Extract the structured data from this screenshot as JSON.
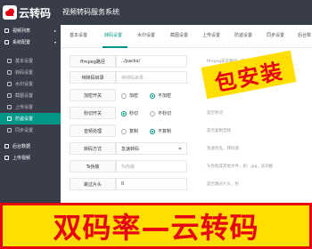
{
  "header": {
    "logo_text": "云转码",
    "app_title": "视频转码服务系统"
  },
  "sidebar": {
    "items": [
      {
        "label": "视频列表",
        "icon": "video-list-icon"
      },
      {
        "label": "系统配置",
        "icon": "settings-icon"
      },
      {
        "label": "基本设置",
        "icon": "basic-icon"
      },
      {
        "label": "转码设置",
        "icon": "transcode-icon"
      },
      {
        "label": "水印设置",
        "icon": "watermark-icon"
      },
      {
        "label": "截图设置",
        "icon": "screenshot-icon"
      },
      {
        "label": "上传设置",
        "icon": "upload-icon"
      },
      {
        "label": "防盗设置",
        "icon": "security-icon"
      },
      {
        "label": "同步设置",
        "icon": "sync-icon"
      },
      {
        "label": "后台数据",
        "icon": "data-icon"
      },
      {
        "label": "上传视频",
        "icon": "upload-video-icon"
      }
    ]
  },
  "tabs": [
    {
      "label": "基本设置"
    },
    {
      "label": "转码设置"
    },
    {
      "label": "水印设置"
    },
    {
      "label": "截图设置"
    },
    {
      "label": "上传设置"
    },
    {
      "label": "防盗设置"
    },
    {
      "label": "同步设置"
    },
    {
      "label": "后台数"
    }
  ],
  "form": {
    "ffmpeg": {
      "label": "ffmpeg路径",
      "value": "../packs/",
      "hint": "ffmpeg安装路径，请"
    },
    "dir": {
      "label": "待转码目录",
      "placeholder": "待转码目录",
      "hint": "服务，会自动对"
    },
    "encrypt": {
      "label": "加密开关",
      "opt1": "加密",
      "opt2": "不加密"
    },
    "second": {
      "label": "秒切开关",
      "opt1": "秒切",
      "opt2": "不秒切",
      "hint": "是否秒切"
    },
    "audio": {
      "label": "音频处理",
      "opt1": "复制",
      "opt2": "不复制",
      "hint": "是否复制音频"
    },
    "mode": {
      "label": "转码方式",
      "value": "急速转码",
      "hint": "急速优先，转码速"
    },
    "ts": {
      "label": "Ts伪装",
      "placeholder": "Ts伪装",
      "hint": "Ts伪装成其他文件，如：jpg，该功能"
    },
    "skip": {
      "label": "跳过片头",
      "value": "0",
      "hint": "是否跳过片头，秒"
    }
  },
  "promo": {
    "stamp_text": "包安装",
    "banner_text": "双码率—云转码"
  },
  "colors": {
    "header_bg": "#393d49",
    "accent": "#009688",
    "promo_yellow": "#ffde00",
    "promo_red": "#e60012"
  }
}
